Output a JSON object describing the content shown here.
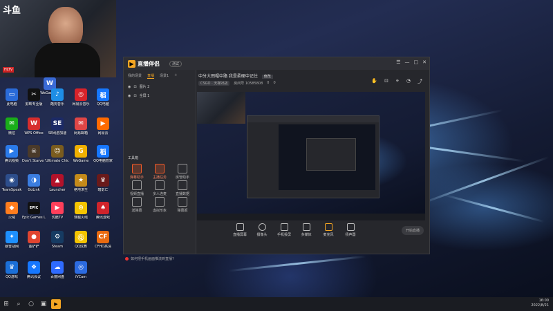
{
  "webcam": {
    "brand": "斗鱼",
    "tag": "HLTV"
  },
  "desktop": {
    "icons": [
      {
        "label": "WeGame版",
        "color": "#3a6ad6",
        "glyph": "W"
      },
      {
        "label": "此电脑",
        "color": "#2a6bd8",
        "glyph": "▭"
      },
      {
        "label": "剪映专业版",
        "color": "#111111",
        "glyph": "✂"
      },
      {
        "label": "酷狗音乐",
        "color": "#1e8ee6",
        "glyph": "♪"
      },
      {
        "label": "网易云音乐",
        "color": "#d8232a",
        "glyph": "◎"
      },
      {
        "label": "QQ电脑",
        "color": "#1677ff",
        "glyph": "稻"
      },
      {
        "label": "微信",
        "color": "#1aad19",
        "glyph": "✉"
      },
      {
        "label": "WPS Office",
        "color": "#d72d2d",
        "glyph": "W"
      },
      {
        "label": "SE网游加速",
        "color": "#1c2a66",
        "glyph": "SE"
      },
      {
        "label": "网易邮箱",
        "color": "#e04646",
        "glyph": "✉"
      },
      {
        "label": "网易云",
        "color": "#ff6a00",
        "glyph": "▶"
      },
      {
        "label": "腾讯视频",
        "color": "#2b7bea",
        "glyph": "▶"
      },
      {
        "label": "Don't Starve Together",
        "color": "#4a3a2a",
        "glyph": "☠"
      },
      {
        "label": "Ultimate Chicken",
        "color": "#7a5c1e",
        "glyph": "☺"
      },
      {
        "label": "WeGame",
        "color": "#f0b000",
        "glyph": "G"
      },
      {
        "label": "QQ电脑管家",
        "color": "#1677ff",
        "glyph": "稻"
      },
      {
        "label": "TeamSpeak",
        "color": "#2d4e8c",
        "glyph": "◉"
      },
      {
        "label": "GoLink",
        "color": "#3b7de0",
        "glyph": "◑"
      },
      {
        "label": "Launcher",
        "color": "#b3122a",
        "glyph": "▲"
      },
      {
        "label": "绝地求生",
        "color": "#c48a1a",
        "glyph": "★"
      },
      {
        "label": "暗影亡",
        "color": "#6a1a1a",
        "glyph": "♛"
      },
      {
        "label": "火绒",
        "color": "#ff7d1e",
        "glyph": "◆"
      },
      {
        "label": "Epic Games Launcher",
        "color": "#111111",
        "glyph": "EPIC"
      },
      {
        "label": "优酷TV",
        "color": "#ff3f5a",
        "glyph": "▶"
      },
      {
        "label": "穿越火线",
        "color": "#f5c400",
        "glyph": "⊙"
      },
      {
        "label": "腾讯游戏",
        "color": "#d0242b",
        "glyph": "♠"
      },
      {
        "label": "暴雪战网",
        "color": "#1e90ff",
        "glyph": "✦"
      },
      {
        "label": "金铲铲",
        "color": "#e04530",
        "glyph": "●"
      },
      {
        "label": "Steam",
        "color": "#163b62",
        "glyph": "⚙"
      },
      {
        "label": "QQ炫舞",
        "color": "#f5c400",
        "glyph": "Ⓠ"
      },
      {
        "label": "CFHD高清",
        "color": "#e86a10",
        "glyph": "CF"
      },
      {
        "label": "QQ游戏",
        "color": "#1b6fd8",
        "glyph": "♛"
      },
      {
        "label": "腾讯会议",
        "color": "#1677ff",
        "glyph": "❖"
      },
      {
        "label": "百度网盘",
        "color": "#2f6bff",
        "glyph": "☁"
      },
      {
        "label": "iVCam",
        "color": "#2c6be0",
        "glyph": "◎"
      }
    ]
  },
  "app": {
    "logo_text": "直播伴侣",
    "version_badge": "测试",
    "win_controls": [
      "☰",
      "—",
      "□",
      "✕"
    ],
    "scene_tabs": [
      "我的场景",
      "直播",
      "场景1"
    ],
    "scene_items": [
      "图片 2",
      "全屏 1"
    ],
    "tools_title": "工具箱",
    "tools": [
      {
        "label": "弹幕助手"
      },
      {
        "label": "主播任务"
      },
      {
        "label": "房管助手"
      },
      {
        "label": "视频直播"
      },
      {
        "label": "多人连麦"
      },
      {
        "label": "直播数据"
      },
      {
        "label": "送弹幕"
      },
      {
        "label": "虚拟形象"
      },
      {
        "label": "弹幕姬"
      }
    ],
    "stream_title": "中分大田帽中路 我是柔硬中记住",
    "stream_title_badge": "修改",
    "game": "CSGO · 天梯对战",
    "room_id": "房间号 10585808",
    "counts": [
      "0",
      "0"
    ],
    "bottom_buttons": [
      "直播屏幕",
      "摄像头",
      "手机投屏",
      "多媒体",
      "麦克风",
      "扬声器"
    ],
    "start_button": "开始直播",
    "notice": "如何把手机画面推流到直播?"
  },
  "taskbar": {
    "start_icon": "⊞",
    "search_icon": "⌕",
    "icons": [
      "○",
      "▣",
      "e"
    ],
    "time": "16:00",
    "date": "2022/8/21"
  }
}
